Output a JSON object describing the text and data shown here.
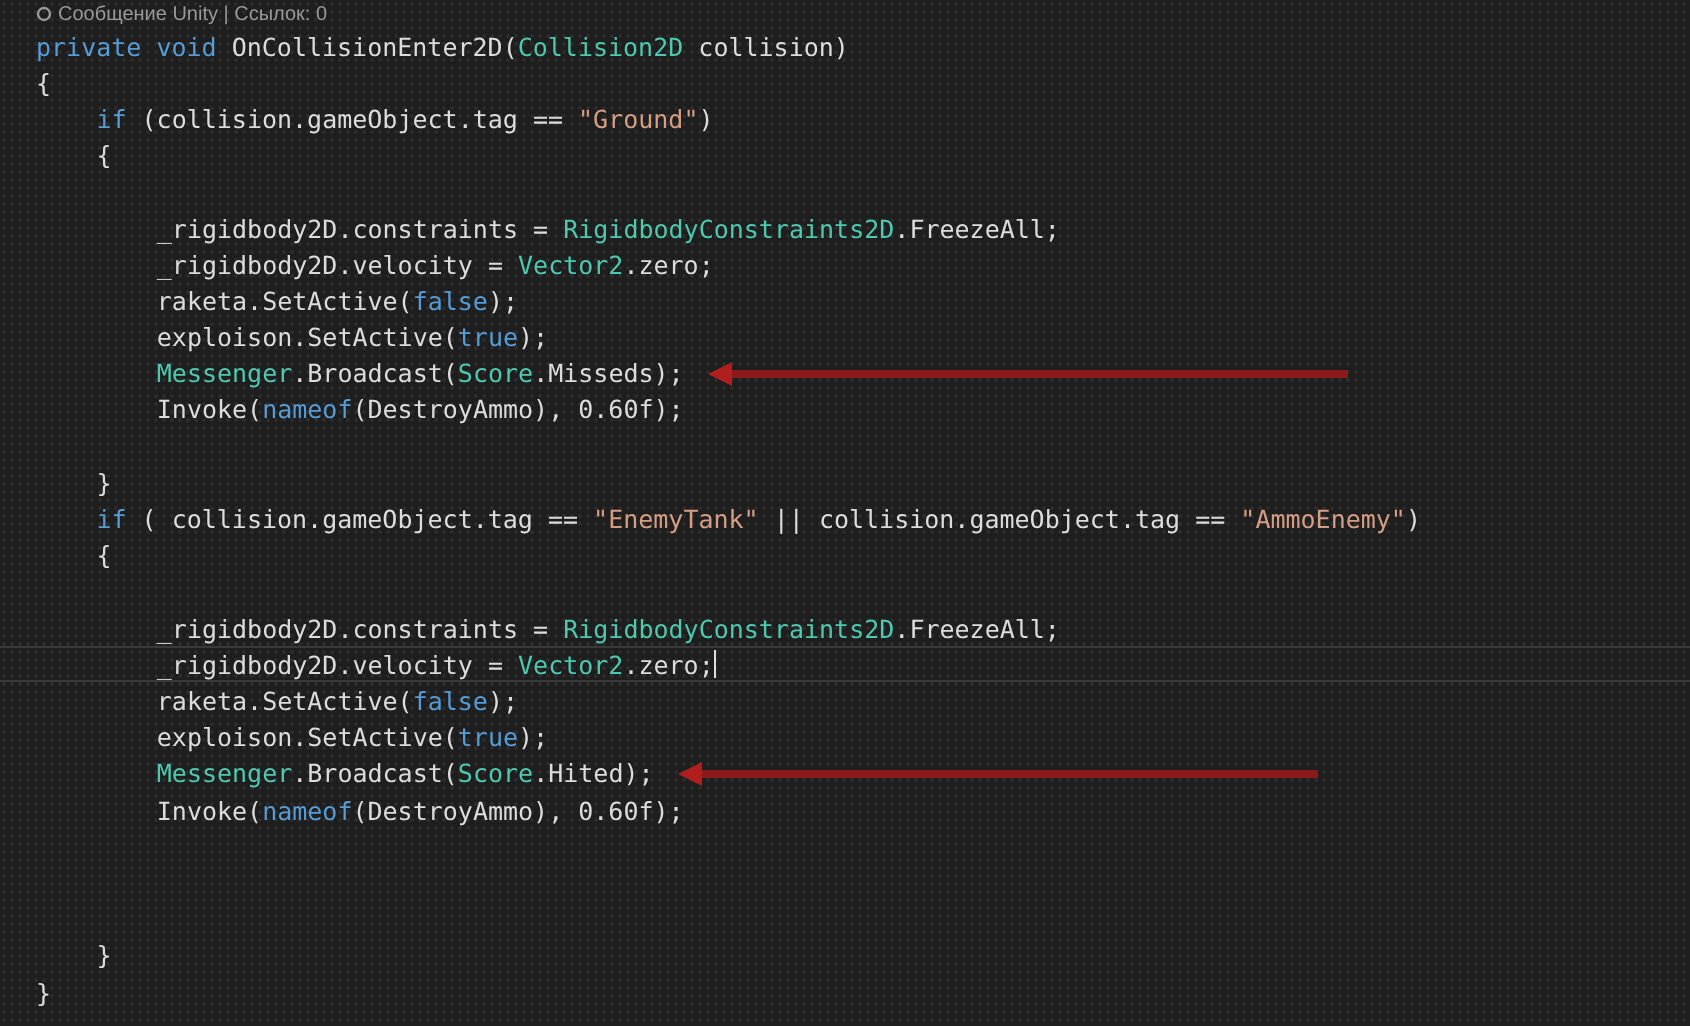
{
  "codelens": "Сообщение Unity | Ссылок: 0",
  "lines": [
    {
      "tokens": [
        {
          "kind": "kw",
          "text": "private"
        },
        {
          "kind": "kw",
          "text": " void"
        },
        {
          "kind": "plain",
          "text": " OnCollisionEnter2D("
        },
        {
          "kind": "type",
          "text": "Collision2D"
        },
        {
          "kind": "plain",
          "text": " collision)"
        }
      ]
    },
    {
      "tokens": [
        {
          "kind": "plain",
          "text": "{"
        }
      ],
      "children": [
        {
          "tokens": [
            {
              "kind": "kw",
              "text": "if"
            },
            {
              "kind": "plain",
              "text": " (collision.gameObject.tag == "
            },
            {
              "kind": "str",
              "text": "\"Ground\""
            },
            {
              "kind": "plain",
              "text": ")"
            }
          ]
        },
        {
          "tokens": [
            {
              "kind": "plain",
              "text": "{"
            }
          ],
          "children": [
            {
              "gap_before": true,
              "tokens": [
                {
                  "kind": "plain",
                  "text": "_rigidbody2D.constraints = "
                },
                {
                  "kind": "type",
                  "text": "RigidbodyConstraints2D"
                },
                {
                  "kind": "plain",
                  "text": ".FreezeAll;"
                }
              ]
            },
            {
              "tokens": [
                {
                  "kind": "plain",
                  "text": "_rigidbody2D.velocity = "
                },
                {
                  "kind": "type",
                  "text": "Vector2"
                },
                {
                  "kind": "plain",
                  "text": ".zero;"
                }
              ]
            },
            {
              "tokens": [
                {
                  "kind": "plain",
                  "text": "raketa.SetActive("
                },
                {
                  "kind": "kw",
                  "text": "false"
                },
                {
                  "kind": "plain",
                  "text": ");"
                }
              ]
            },
            {
              "tokens": [
                {
                  "kind": "plain",
                  "text": "exploison.SetActive("
                },
                {
                  "kind": "kw",
                  "text": "true"
                },
                {
                  "kind": "plain",
                  "text": ");"
                }
              ]
            },
            {
              "arrow": true,
              "tokens": [
                {
                  "kind": "type",
                  "text": "Messenger"
                },
                {
                  "kind": "plain",
                  "text": ".Broadcast("
                },
                {
                  "kind": "type",
                  "text": "Score"
                },
                {
                  "kind": "plain",
                  "text": ".Misseds);"
                }
              ]
            },
            {
              "tokens": [
                {
                  "kind": "plain",
                  "text": "Invoke("
                },
                {
                  "kind": "kw",
                  "text": "nameof"
                },
                {
                  "kind": "plain",
                  "text": "(DestroyAmmo), 0.60f);"
                }
              ]
            }
          ]
        },
        {
          "gap_before": true,
          "tokens": [
            {
              "kind": "plain",
              "text": "}"
            }
          ]
        },
        {
          "tokens": [
            {
              "kind": "kw",
              "text": "if"
            },
            {
              "kind": "plain",
              "text": " ( collision.gameObject.tag == "
            },
            {
              "kind": "str",
              "text": "\"EnemyTank\""
            },
            {
              "kind": "plain",
              "text": " || collision.gameObject.tag == "
            },
            {
              "kind": "str",
              "text": "\"AmmoEnemy\""
            },
            {
              "kind": "plain",
              "text": ")"
            }
          ]
        },
        {
          "tokens": [
            {
              "kind": "plain",
              "text": "{"
            }
          ],
          "children": [
            {
              "gap_before": true,
              "tokens": [
                {
                  "kind": "plain",
                  "text": "_rigidbody2D.constraints = "
                },
                {
                  "kind": "type",
                  "text": "RigidbodyConstraints2D"
                },
                {
                  "kind": "plain",
                  "text": ".FreezeAll;"
                }
              ]
            },
            {
              "current": true,
              "tokens": [
                {
                  "kind": "plain",
                  "text": "_rigidbody2D.velocity = "
                },
                {
                  "kind": "type",
                  "text": "Vector2"
                },
                {
                  "kind": "plain",
                  "text": ".zero;"
                }
              ]
            },
            {
              "tokens": [
                {
                  "kind": "plain",
                  "text": "raketa.SetActive("
                },
                {
                  "kind": "kw",
                  "text": "false"
                },
                {
                  "kind": "plain",
                  "text": ");"
                }
              ]
            },
            {
              "tokens": [
                {
                  "kind": "plain",
                  "text": "exploison.SetActive("
                },
                {
                  "kind": "kw",
                  "text": "true"
                },
                {
                  "kind": "plain",
                  "text": ");"
                }
              ]
            },
            {
              "arrow": true,
              "tokens": [
                {
                  "kind": "type",
                  "text": "Messenger"
                },
                {
                  "kind": "plain",
                  "text": ".Broadcast("
                },
                {
                  "kind": "type",
                  "text": "Score"
                },
                {
                  "kind": "plain",
                  "text": ".Hited);"
                }
              ]
            },
            {
              "tokens": [
                {
                  "kind": "plain",
                  "text": "Invoke("
                },
                {
                  "kind": "kw",
                  "text": "nameof"
                },
                {
                  "kind": "plain",
                  "text": "(DestroyAmmo), 0.60f);"
                }
              ]
            }
          ]
        },
        {
          "gap_before": true,
          "gap_wide": true,
          "tokens": [
            {
              "kind": "plain",
              "text": "}"
            }
          ]
        }
      ]
    },
    {
      "tokens": [
        {
          "kind": "plain",
          "text": "}"
        }
      ]
    }
  ]
}
